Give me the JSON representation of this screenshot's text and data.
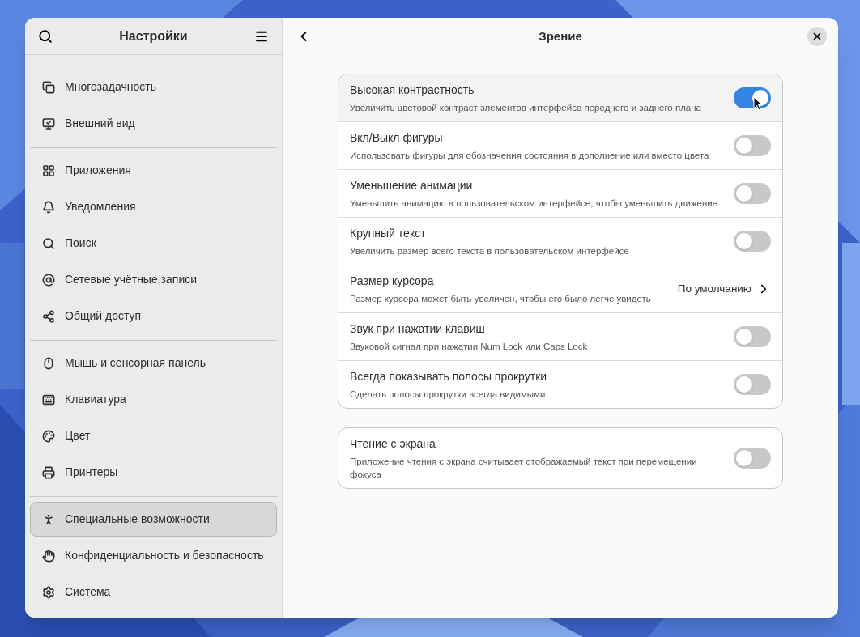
{
  "sidebar": {
    "title": "Настройки",
    "groups": [
      [
        {
          "label": "Многозадачность",
          "selected": false
        },
        {
          "label": "Внешний вид",
          "selected": false
        }
      ],
      [
        {
          "label": "Приложения",
          "selected": false
        },
        {
          "label": "Уведомления",
          "selected": false
        },
        {
          "label": "Поиск",
          "selected": false
        },
        {
          "label": "Сетевые учётные записи",
          "selected": false
        },
        {
          "label": "Общий доступ",
          "selected": false
        }
      ],
      [
        {
          "label": "Мышь и сенсорная панель",
          "selected": false
        },
        {
          "label": "Клавиатура",
          "selected": false
        },
        {
          "label": "Цвет",
          "selected": false
        },
        {
          "label": "Принтеры",
          "selected": false
        }
      ],
      [
        {
          "label": "Специальные возможности",
          "selected": true
        },
        {
          "label": "Конфиденциальность и безопасность",
          "selected": false
        },
        {
          "label": "Система",
          "selected": false
        }
      ]
    ]
  },
  "page": {
    "title": "Зрение",
    "cards": [
      [
        {
          "kind": "switch",
          "title": "Высокая контрастность",
          "subtitle": "Увеличить цветовой контраст элементов интерфейса переднего и заднего плана",
          "on": true,
          "hovered": true
        },
        {
          "kind": "switch",
          "title": "Вкл/Выкл фигуры",
          "subtitle": "Использовать фигуры для обозначения состояния в дополнение или вместо цвета",
          "on": false,
          "hovered": false
        },
        {
          "kind": "switch",
          "title": "Уменьшение анимации",
          "subtitle": "Уменьшить анимацию в пользовательском интерфейсе, чтобы уменьшить движение",
          "on": false,
          "hovered": false
        },
        {
          "kind": "switch",
          "title": "Крупный текст",
          "subtitle": "Увеличить размер всего текста в пользовательском интерфейсе",
          "on": false,
          "hovered": false
        },
        {
          "kind": "link",
          "title": "Размер курсора",
          "subtitle": "Размер курсора может быть увеличен, чтобы его было легче увидеть",
          "value": "По умолчанию",
          "hovered": false
        },
        {
          "kind": "switch",
          "title": "Звук при нажатии клавиш",
          "subtitle": "Звуковой сигнал при нажатии Num Lock или Caps Lock",
          "on": false,
          "hovered": false
        },
        {
          "kind": "switch",
          "title": "Всегда показывать полосы прокрутки",
          "subtitle": "Сделать полосы прокрутки всегда видимыми",
          "on": false,
          "hovered": false
        }
      ],
      [
        {
          "kind": "switch",
          "title": "Чтение с экрана",
          "subtitle": "Приложение чтения с экрана считывает отображаемый текст при перемещении фокуса",
          "on": false,
          "hovered": false
        }
      ]
    ]
  }
}
